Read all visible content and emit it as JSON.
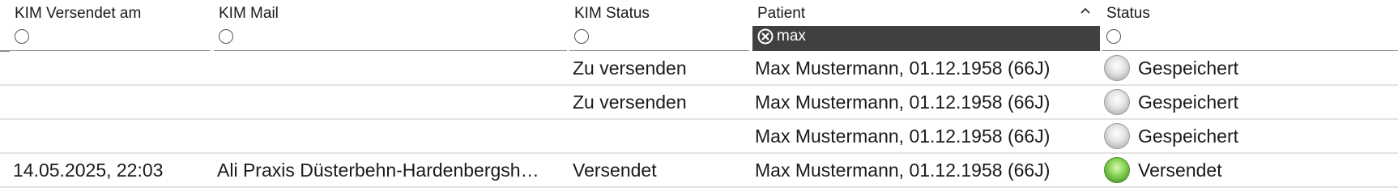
{
  "columns": {
    "kim_versendet_am": {
      "title": "KIM Versendet am"
    },
    "kim_mail": {
      "title": "KIM Mail"
    },
    "kim_status": {
      "title": "KIM Status"
    },
    "patient": {
      "title": "Patient",
      "filter_value": "max",
      "sort": "ascending"
    },
    "status": {
      "title": "Status"
    }
  },
  "rows": [
    {
      "kim_versendet_am": "",
      "kim_mail": "",
      "kim_status": "Zu versenden",
      "patient": "Max Mustermann, 01.12.1958 (66J)",
      "status": "Gespeichert",
      "status_color": "gray"
    },
    {
      "kim_versendet_am": "",
      "kim_mail": "",
      "kim_status": "Zu versenden",
      "patient": "Max Mustermann, 01.12.1958 (66J)",
      "status": "Gespeichert",
      "status_color": "gray"
    },
    {
      "kim_versendet_am": "",
      "kim_mail": "",
      "kim_status": "",
      "patient": "Max Mustermann, 01.12.1958 (66J)",
      "status": "Gespeichert",
      "status_color": "gray"
    },
    {
      "kim_versendet_am": "14.05.2025, 22:03",
      "kim_mail": "Ali Praxis Düsterbehn-Hardenbergsh…",
      "kim_status": "Versendet",
      "patient": "Max Mustermann, 01.12.1958 (66J)",
      "status": "Versendet",
      "status_color": "green"
    }
  ],
  "colors": {
    "active_filter_bg": "#404040",
    "led_gray": "#bdbdbd",
    "led_green": "#58a52e"
  }
}
